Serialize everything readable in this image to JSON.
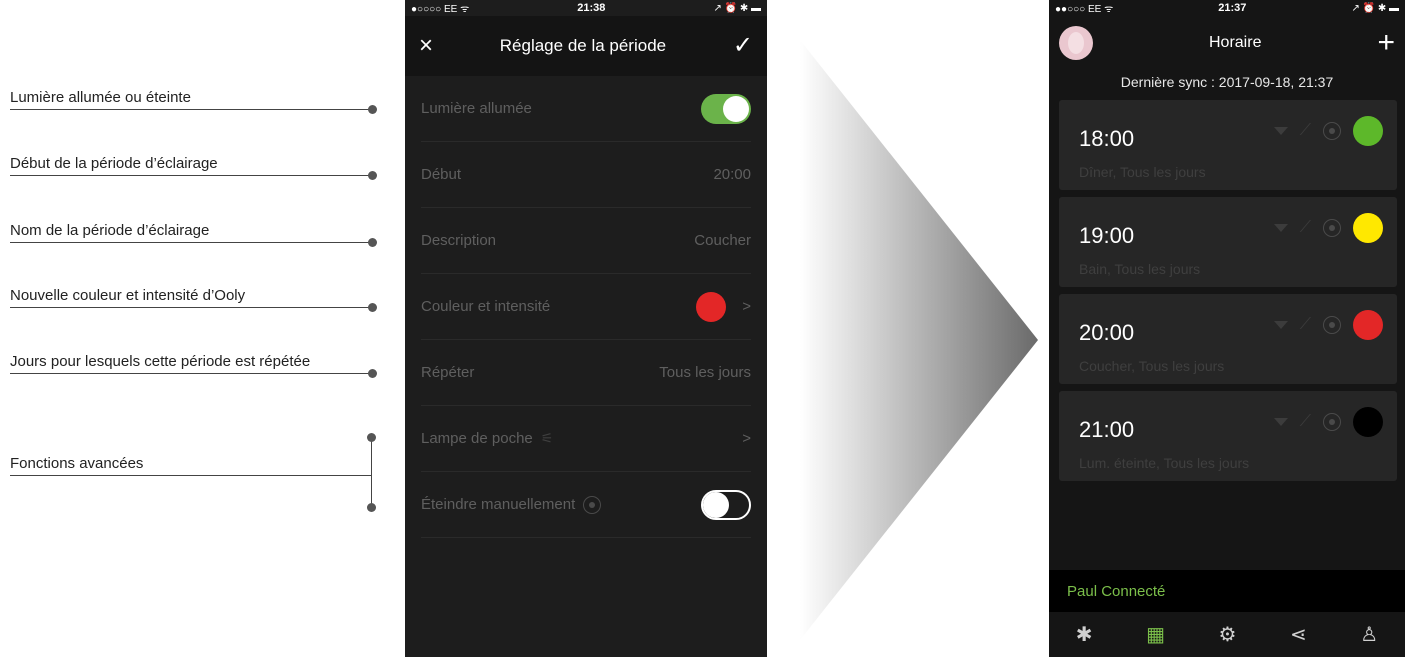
{
  "annotations": [
    {
      "label": "Lumière allumée ou éteinte"
    },
    {
      "label": "Début de la période d’éclairage"
    },
    {
      "label": "Nom de la période d’éclairage"
    },
    {
      "label": "Nouvelle couleur et intensité d’Ooly"
    },
    {
      "label": "Jours pour lesquels cette période est répétée"
    },
    {
      "label": "Fonctions avancées"
    }
  ],
  "phone1": {
    "status": {
      "carrier": "●○○○○ EE ᯤ",
      "time": "21:38",
      "right": "↗ ⏰ ✱ ▬"
    },
    "title": "Réglage de la période",
    "close_icon": "×",
    "confirm_icon": "✓",
    "rows": {
      "light_on": {
        "label": "Lumière allumée",
        "toggle": "on"
      },
      "start": {
        "label": "Début",
        "value": "20:00"
      },
      "description": {
        "label": "Description",
        "value": "Coucher"
      },
      "color": {
        "label": "Couleur et intensité",
        "color": "#e32727",
        "chevron": ">"
      },
      "repeat": {
        "label": "Répéter",
        "value": "Tous les jours"
      },
      "flashlight": {
        "label": "Lampe de poche",
        "chevron": ">"
      },
      "manual_off": {
        "label": "Éteindre manuellement",
        "toggle": "off"
      }
    }
  },
  "phone2": {
    "status": {
      "carrier": "●●○○○ EE ᯤ",
      "time": "21:37",
      "right": "↗ ⏰ ✱ ▬"
    },
    "title": "Horaire",
    "plus_icon": "+",
    "sync": "Dernière sync : 2017-09-18, 21:37",
    "cards": [
      {
        "time": "18:00",
        "desc": "Dîner, Tous les jours",
        "color": "#5db82a"
      },
      {
        "time": "19:00",
        "desc": "Bain, Tous les jours",
        "color": "#ffe800"
      },
      {
        "time": "20:00",
        "desc": "Coucher, Tous les jours",
        "color": "#e32727"
      },
      {
        "time": "21:00",
        "desc": "Lum. éteinte, Tous les jours",
        "color": "#000000"
      }
    ],
    "connected": "Paul Connecté",
    "tabs": [
      {
        "icon": "bluetooth-icon",
        "glyph": "✱"
      },
      {
        "icon": "calendar-icon",
        "glyph": "▦"
      },
      {
        "icon": "gear-icon",
        "glyph": "⚙"
      },
      {
        "icon": "share-icon",
        "glyph": "⋖"
      },
      {
        "icon": "user-icon",
        "glyph": "♙"
      }
    ]
  }
}
